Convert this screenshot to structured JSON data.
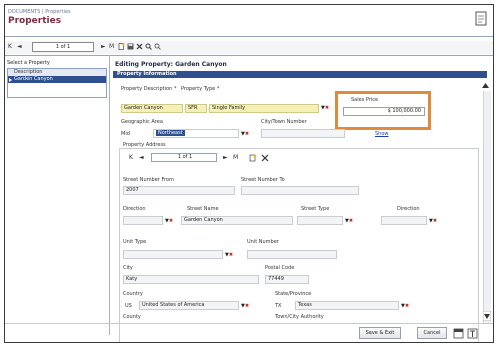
{
  "header": {
    "breadcrumb": "DOCUMENTS | Properties",
    "title": "Properties"
  },
  "toolbar": {
    "first": "K",
    "prev": "◄",
    "page": "1 of 1",
    "next": "►",
    "last": "M"
  },
  "left_panel": {
    "heading": "Select a Property",
    "rows": [
      "Description",
      "Garden Canyon"
    ]
  },
  "section": {
    "title": "Editing Property: Garden Canyon",
    "band": "Property Information"
  },
  "form": {
    "property_description_label": "Property Description *",
    "property_type_label": "Property Type *",
    "sales_price_label": "Sales Price",
    "property_description_value": "Garden Canyon",
    "property_type_code": "SFR",
    "property_type_value": "Single Family",
    "sales_price_value": "$ 100,000.00",
    "geographic_area_label": "Geographic Area",
    "city_town_number_label": "City/Town Number",
    "geo_code": "Mid",
    "geo_selected": "Northeast",
    "show_link": "Show",
    "property_address_label": "Property Address",
    "address_page": "1 of 1",
    "street_number_from_label": "Street Number From",
    "street_number_to_label": "Street Number To",
    "street_number_from_value": "2007",
    "direction_label": "Direction",
    "street_name_label": "Street Name",
    "street_type_label": "Street Type",
    "direction2_label": "Direction",
    "street_name_value": "Garden Canyon",
    "unit_type_label": "Unit Type",
    "unit_number_label": "Unit Number",
    "city_label": "City",
    "postal_code_label": "Postal Code",
    "city_value": "Katy",
    "postal_code_value": "77449",
    "country_label": "Country",
    "state_label": "State/Province",
    "country_code": "US",
    "country_value": "United States of America",
    "state_code": "TX",
    "state_value": "Texas",
    "county_label": "County",
    "township_label": "Town/City Authority"
  },
  "buttons": {
    "save_exit": "Save & Exit",
    "cancel": "Cancel"
  },
  "colors": {
    "accent": "#2f4f8f",
    "title": "#7a2c40",
    "highlight_box": "#e08a3a",
    "required_field": "#f5f1b4"
  }
}
